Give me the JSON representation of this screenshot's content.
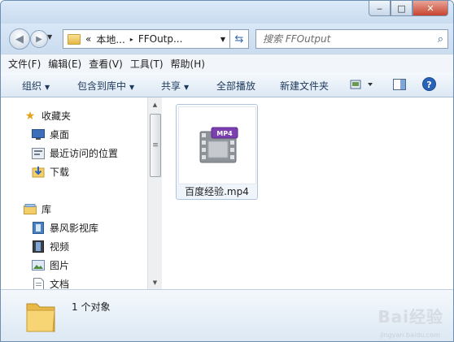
{
  "titlebar": {
    "minimize": "‒",
    "maximize": "□",
    "close": "✕"
  },
  "address": {
    "overflow": "«",
    "segments": [
      "本地...",
      "FFOutp..."
    ],
    "separator": "▸"
  },
  "search": {
    "placeholder": "搜索 FFOutput"
  },
  "menu": [
    "文件(F)",
    "编辑(E)",
    "查看(V)",
    "工具(T)",
    "帮助(H)"
  ],
  "toolbar": {
    "organize": "组织",
    "include_in_library": "包含到库中",
    "share": "共享",
    "play_all": "全部播放",
    "new_folder": "新建文件夹"
  },
  "nav": {
    "favorites": "收藏夹",
    "favorites_items": [
      "桌面",
      "最近访问的位置",
      "下载"
    ],
    "libraries": "库",
    "library_items": [
      "暴风影视库",
      "视频",
      "图片",
      "文档"
    ]
  },
  "files": [
    {
      "name": "百度经验.mp4",
      "badge": "MP4",
      "icon": "video-file-icon"
    }
  ],
  "status": {
    "count_text": "1 个对象"
  },
  "watermark": {
    "text": "Bai经验",
    "url": "jingyan.baidu.com"
  },
  "colors": {
    "accent": "#1e395b",
    "titlebar": "#cfe0f3",
    "mp4_badge": "#7b3fb0"
  }
}
